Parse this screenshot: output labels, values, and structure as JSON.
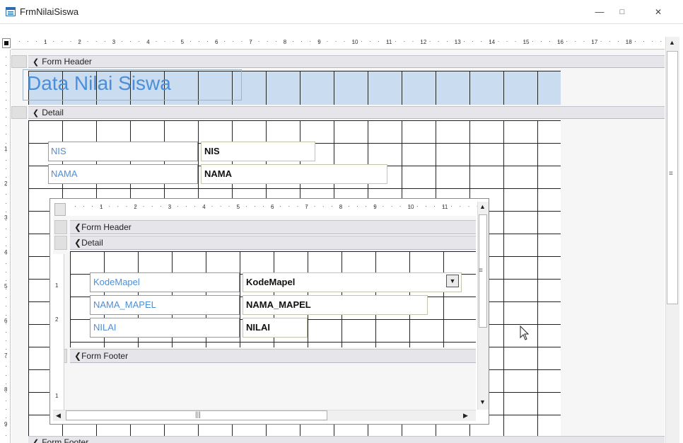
{
  "window": {
    "title": "FrmNilaiSiswa",
    "minimize_glyph": "—",
    "maximize_glyph": "□",
    "close_glyph": "✕"
  },
  "ruler": {
    "horizontal_labels": [
      "1",
      "2",
      "3",
      "4",
      "5",
      "6",
      "7",
      "8",
      "9",
      "10",
      "11",
      "12",
      "13",
      "14",
      "15",
      "16",
      "17",
      "18"
    ],
    "vertical_labels": [
      "1",
      "2",
      "3",
      "4",
      "5",
      "6",
      "7",
      "8",
      "9"
    ]
  },
  "form": {
    "sections": {
      "header": "Form Header",
      "detail": "Detail",
      "footer": "Form Footer"
    },
    "header_title": "Data Nilai Siswa",
    "fields": [
      {
        "label": "NIS",
        "control": "NIS"
      },
      {
        "label": "NAMA",
        "control": "NAMA"
      }
    ]
  },
  "subform": {
    "ruler_labels": [
      "1",
      "2",
      "3",
      "4",
      "5",
      "6",
      "7",
      "8",
      "9",
      "10",
      "11"
    ],
    "vertical_labels": [
      "1",
      "2"
    ],
    "footer_vertical_labels": [
      "1"
    ],
    "sections": {
      "header": "Form Header",
      "detail": "Detail",
      "footer": "Form Footer"
    },
    "fields": [
      {
        "label": "KodeMapel",
        "control": "KodeMapel",
        "type": "combo"
      },
      {
        "label": "NAMA_MAPEL",
        "control": "NAMA_MAPEL",
        "type": "text"
      },
      {
        "label": "NILAI",
        "control": "NILAI",
        "type": "text"
      }
    ]
  },
  "icons": {
    "window": "form-icon",
    "section_marker": "section-arrow-icon",
    "combo": "dropdown-arrow-icon",
    "pointer": "mouse-pointer-icon"
  }
}
